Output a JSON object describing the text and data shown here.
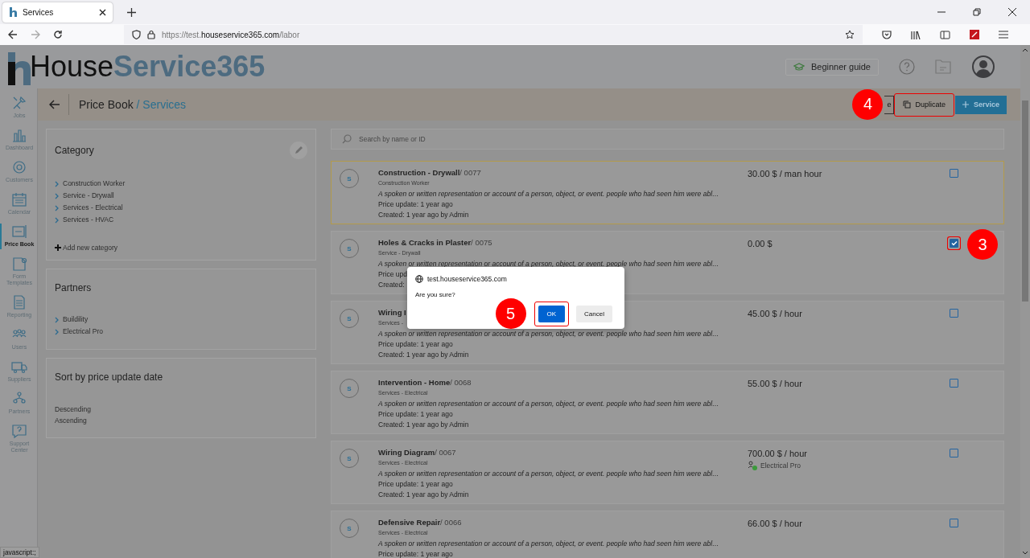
{
  "browser": {
    "tab_title": "Services",
    "url_prefix": "https://test.",
    "url_domain": "houseservice365.com",
    "url_path": "/labor",
    "status_text": "javascript:;"
  },
  "header": {
    "logo_primary": "House",
    "logo_secondary": "Service365",
    "guide_button": "Beginner guide"
  },
  "sidebar": [
    {
      "label": "Jobs",
      "kind": "tools",
      "selected": false
    },
    {
      "label": "Dashboard",
      "kind": "chart",
      "selected": false
    },
    {
      "label": "Customers",
      "kind": "target",
      "selected": false
    },
    {
      "label": "Calendar",
      "kind": "calendar",
      "selected": false
    },
    {
      "label": "Price Book",
      "kind": "price",
      "selected": true
    },
    {
      "label": "Form Templates",
      "kind": "form",
      "selected": false
    },
    {
      "label": "Reporting",
      "kind": "report",
      "selected": false
    },
    {
      "label": "Users",
      "kind": "users",
      "selected": false
    },
    {
      "label": "Suppliers",
      "kind": "truck",
      "selected": false
    },
    {
      "label": "Partners",
      "kind": "partners",
      "selected": false
    },
    {
      "label": "Support Center",
      "kind": "help",
      "selected": false
    }
  ],
  "page": {
    "title": "Price Book",
    "subtitle": "/ Services"
  },
  "actions": {
    "covered_button": "e",
    "covered_step": "4",
    "duplicate": "Duplicate",
    "duplicate_outlined": true,
    "add": "Service"
  },
  "category": {
    "title": "Category",
    "items": [
      "Construction Worker",
      "Service - Drywall",
      "Services - Electrical",
      "Services - HVAC"
    ],
    "add_label": "Add new category"
  },
  "partners": {
    "title": "Partners",
    "items": [
      "Buildility",
      "Electrical Pro"
    ]
  },
  "sort": {
    "title": "Sort by price update date",
    "options": [
      "Descending",
      "Ascending"
    ]
  },
  "search": {
    "placeholder": "Search by name or ID"
  },
  "services": [
    {
      "badge": "S",
      "name": "Construction - Drywall",
      "code": "/ 0077",
      "category": "Construction Worker",
      "description": "A spoken or written representation or account of a person, object, or event. people who had seen him were abl…",
      "price_update": "Price update: 1 year ago",
      "created": "Created: 1 year ago by Admin",
      "price": "30.00 $ / man hour",
      "highlighted": true,
      "checked": false
    },
    {
      "badge": "S",
      "name": "Holes & Cracks in Plaster",
      "code": "/ 0075",
      "category": "Service - Drywall",
      "description": "A spoken or written representation or account of a person, object, or event. people who had seen him were abl…",
      "price_update": "Price upd",
      "created": "Created:",
      "price": "0.00 $",
      "highlighted": false,
      "checked": true,
      "step": "3"
    },
    {
      "badge": "S",
      "name": "Wiring I",
      "category": "Services -",
      "description": "A spoken or written representation or account of a person, object, or event. people who had seen him were abl…",
      "price_update": "Price update: 1 year ago",
      "created": "Created: 1 year ago by Admin",
      "price": "45.00 $ / hour",
      "highlighted": false,
      "checked": false
    },
    {
      "badge": "S",
      "name": "Intervention - Home",
      "code": "/ 0068",
      "category": "Services - Electrical",
      "description": "A spoken or written representation or account of a person, object, or event. people who had seen him were abl…",
      "price_update": "Price update: 1 year ago",
      "created": "Created: 1 year ago by Admin",
      "price": "55.00 $ / hour",
      "highlighted": false,
      "checked": false
    },
    {
      "badge": "S",
      "name": "Wiring Diagram",
      "code": "/ 0067",
      "category": "Services - Electrical",
      "description": "A spoken or written representation or account of a person, object, or event. people who had seen him were abl…",
      "price_update": "Price update: 1 year ago",
      "created": "Created: 1 year ago by Admin",
      "price": "700.00 $ / hour",
      "partner": "Electrical Pro",
      "highlighted": false,
      "checked": false
    },
    {
      "badge": "S",
      "name": "Defensive Repair",
      "code": "/ 0066",
      "category": "Services - Electrical",
      "description": "A spoken or written representation or account of a person, object, or event. people who had seen him were abl…",
      "price_update": "Price update: 1 year ago",
      "price": "66.00 $ / hour",
      "highlighted": false,
      "checked": false
    }
  ],
  "dialog": {
    "origin": "test.houseservice365.com",
    "message": "Are you sure?",
    "buttons": [
      {
        "label": "OK",
        "primary": true,
        "step": "5"
      },
      {
        "label": "Cancel",
        "primary": false
      }
    ]
  }
}
